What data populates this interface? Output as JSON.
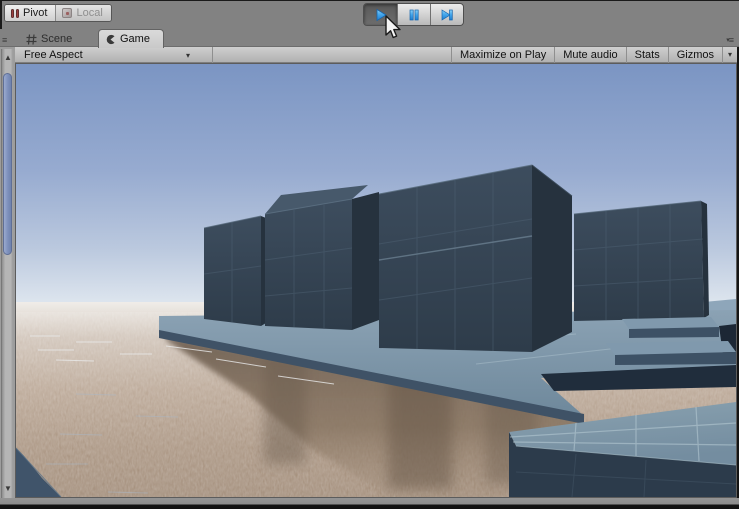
{
  "topbar": {
    "pivot_label": "Pivot",
    "local_label": "Local"
  },
  "tabs": {
    "scene_label": "Scene",
    "game_label": "Game"
  },
  "game_toolbar": {
    "aspect_label": "Free Aspect",
    "buttons": [
      "Maximize on Play",
      "Mute audio",
      "Stats",
      "Gizmos"
    ]
  },
  "icons": {
    "menu": "≡",
    "dropdown": "▾",
    "scrollbar_up": "▲",
    "scrollbar_down": "▼"
  },
  "colors": {
    "accent_play_blue": "#3d9fe8",
    "chrome_gray": "#828282",
    "sky_top": "#7b95c3",
    "sky_horizon": "#f3f5f5",
    "water_bottom": "#a38e7b",
    "cube_face": "#36454f",
    "platform": "#7e97ac",
    "reflection_brown": "#85725f",
    "scroll_thumb_blue": "#7d90bc"
  }
}
